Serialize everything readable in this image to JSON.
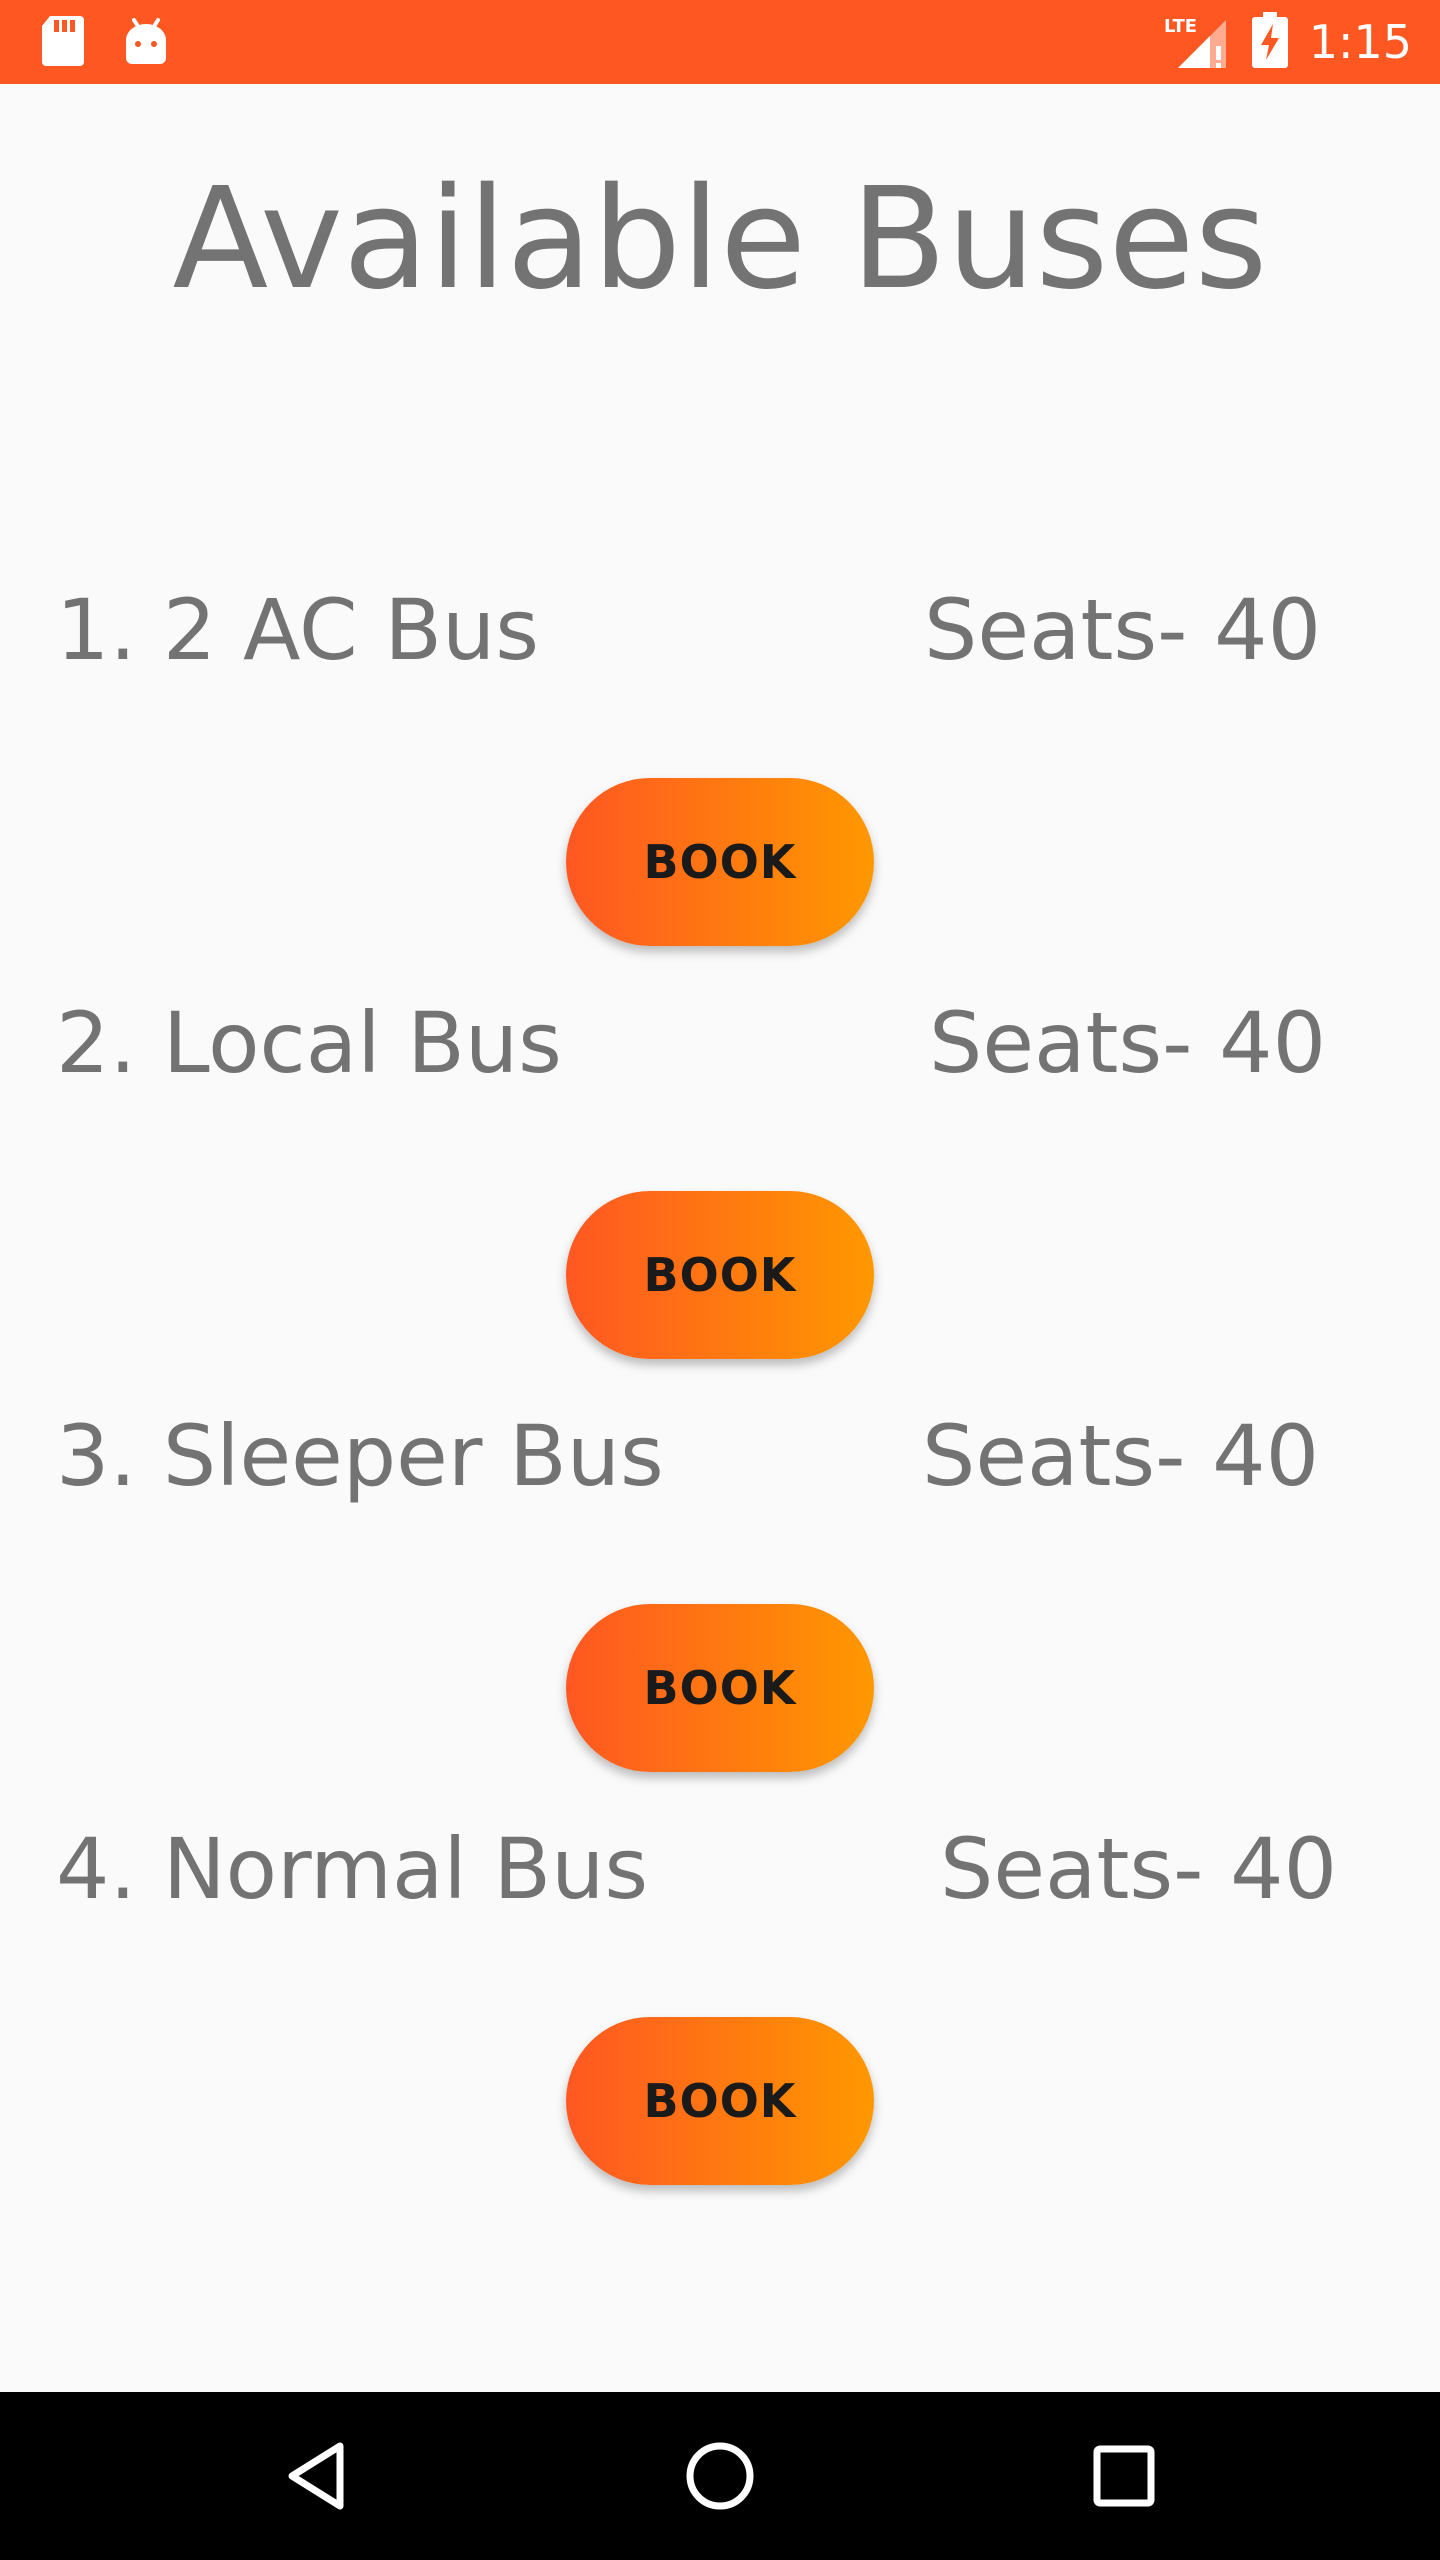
{
  "status_bar": {
    "time": "1:15",
    "network": "LTE",
    "icons": [
      "sd-card-icon",
      "android-icon",
      "signal-icon",
      "battery-charging-icon"
    ]
  },
  "page": {
    "title": "Available Buses"
  },
  "buses": [
    {
      "name": "1. 2 AC Bus",
      "seats": "Seats- 40",
      "button": "BOOK"
    },
    {
      "name": "2. Local Bus",
      "seats": "Seats- 40",
      "button": "BOOK"
    },
    {
      "name": "3. Sleeper Bus",
      "seats": "Seats- 40",
      "button": "BOOK"
    },
    {
      "name": "4. Normal Bus",
      "seats": "Seats- 40",
      "button": "BOOK"
    }
  ],
  "nav_bar": {
    "icons": [
      "back-icon",
      "home-icon",
      "recents-icon"
    ]
  },
  "colors": {
    "accent": "#FF5722",
    "gradient_end": "#FF9800",
    "text": "#737373"
  }
}
